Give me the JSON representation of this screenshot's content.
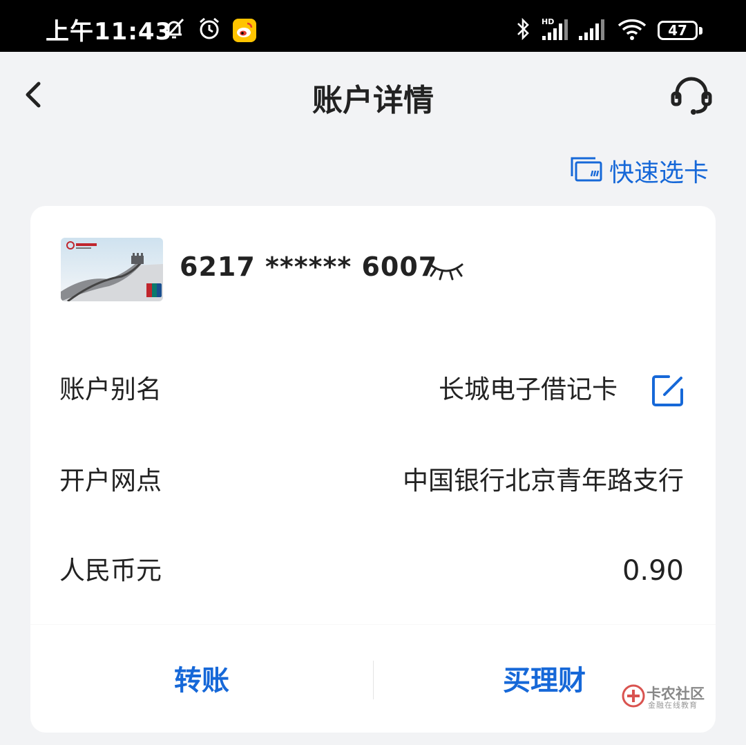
{
  "status_bar": {
    "time": "上午11:43",
    "hd_label": "HD",
    "battery": "47"
  },
  "header": {
    "title": "账户详情"
  },
  "quick_select": {
    "label": "快速选卡"
  },
  "account": {
    "card_number": "6217 ****** 6007",
    "rows": [
      {
        "label": "账户别名",
        "value": "长城电子借记卡"
      },
      {
        "label": "开户网点",
        "value": "中国银行北京青年路支行"
      },
      {
        "label": "人民币元",
        "value": "0.90"
      }
    ]
  },
  "actions": {
    "transfer": "转账",
    "buy_wealth": "买理财"
  },
  "watermark": {
    "title": "卡农社区",
    "subtitle": "金融在线教育"
  },
  "colors": {
    "accent": "#1668d8",
    "background": "#f2f3f5",
    "card": "#ffffff",
    "text": "#222222"
  }
}
